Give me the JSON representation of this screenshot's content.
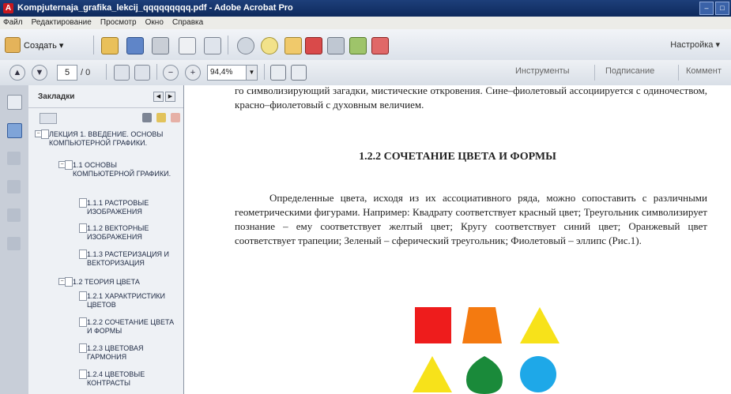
{
  "window": {
    "title": "Kompjuternaja_grafika_lekcij_qqqqqqqqq.pdf - Adobe Acrobat Pro"
  },
  "menu": [
    "Файл",
    "Редактирование",
    "Просмотр",
    "Окно",
    "Справка"
  ],
  "toolbar": {
    "create_label": "Создать ▾",
    "settings_label": "Настройка ▾"
  },
  "nav": {
    "page_current": "5",
    "page_total": "/ 0",
    "zoom": "94,4%"
  },
  "tabs": [
    "Инструменты",
    "Подписание",
    "Коммент"
  ],
  "bookmarks": {
    "title": "Закладки",
    "items": [
      {
        "label": "ЛЕКЦИЯ 1. ВВЕДЕНИЕ. ОСНОВЫ КОМПЬЮТЕРНОЙ ГРАФИКИ."
      },
      {
        "label": "1.1 ОСНОВЫ КОМПЬЮТЕРНОЙ ГРАФИКИ."
      },
      {
        "label": "1.1.1 РАСТРОВЫЕ ИЗОБРАЖЕНИЯ"
      },
      {
        "label": "1.1.2 ВЕКТОРНЫЕ ИЗОБРАЖЕНИЯ"
      },
      {
        "label": "1.1.3 РАСТЕРИЗАЦИЯ И ВЕКТОРИЗАЦИЯ"
      },
      {
        "label": "1.2 ТЕОРИЯ ЦВЕТА"
      },
      {
        "label": "1.2.1 ХАРАКТРИСТИКИ ЦВЕТОВ"
      },
      {
        "label": "1.2.2 СОЧЕТАНИЕ ЦВЕТА И ФОРМЫ"
      },
      {
        "label": "1.2.3 ЦВЕТОВАЯ ГАРМОНИЯ"
      },
      {
        "label": "1.2.4 ЦВЕТОВЫЕ КОНТРАСТЫ"
      }
    ]
  },
  "document": {
    "para_top": "го символизирующий загадки, мистические откровения. Сине–фиолетовый ассоциируется с одиночеством, красно–фиолетовый с духовным величием.",
    "heading": "1.2.2 СОЧЕТАНИЕ ЦВЕТА И ФОРМЫ",
    "para_main": "Определенные цвета, исходя из их ассоциативного ряда, можно сопоставить с различными геометрическими фигурами. Например: Квадрату соответствует красный цвет; Треугольник символизирует познание – ему соответствует желтый цвет; Кругу соответствует синий цвет; Оранжевый цвет соответствует трапеции; Зеленый – сферический треугольник; Фиолетовый – эллипс (Рис.1).",
    "shape_colors": {
      "square": "#ee1c1c",
      "trapezoid": "#f47a10",
      "triangle": "#f7e21a",
      "spherical_triangle": "#1a8a3a",
      "circle": "#1ea8e8"
    }
  }
}
